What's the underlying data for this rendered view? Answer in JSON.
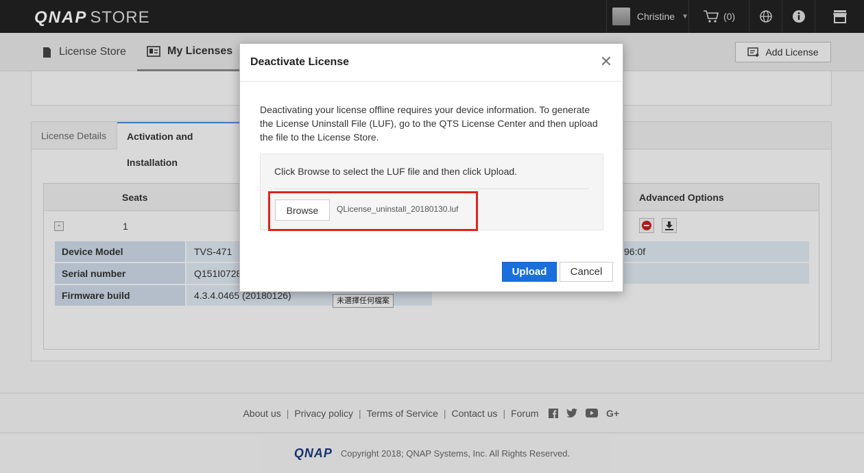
{
  "topbar": {
    "brand": "QNAP",
    "store": "STORE",
    "user_name": "Christine",
    "cart_count": "(0)"
  },
  "nav": {
    "license_store": "License Store",
    "my_licenses": "My Licenses",
    "add_license": "Add License"
  },
  "tabs": {
    "license_details": "License Details",
    "activation": "Activation and Installation"
  },
  "table": {
    "seats_header": "Seats",
    "advanced_header": "Advanced Options",
    "toggle": "-",
    "seat_value": "1",
    "rows": [
      {
        "label": "Device Model",
        "value": "TVS-471",
        "extra": "96:0f"
      },
      {
        "label": "Serial number",
        "value": "Q151I0728",
        "extra": ""
      },
      {
        "label": "Firmware build",
        "value": "4.3.4.0465 (20180126)",
        "extra": ""
      }
    ]
  },
  "tooltip": "未選擇任何檔案",
  "modal": {
    "title": "Deactivate License",
    "description": "Deactivating your license offline requires your device information. To generate the License Uninstall File (LUF), go to the QTS License Center and then upload the file to the License Store.",
    "instruction": "Click Browse to select the LUF file and then click Upload.",
    "browse": "Browse",
    "file_name": "QLicense_uninstall_20180130.luf",
    "upload": "Upload",
    "cancel": "Cancel"
  },
  "footer": {
    "links": [
      "About us",
      "Privacy policy",
      "Terms of Service",
      "Contact us",
      "Forum"
    ],
    "social_icons": [
      "facebook-icon",
      "twitter-icon",
      "youtube-icon",
      "google-plus-icon"
    ],
    "logo": "QNAP",
    "copyright": "Copyright 2018; QNAP Systems, Inc. All Rights Reserved."
  },
  "colors": {
    "accent": "#1a6fdc",
    "highlight_frame": "#d9251d",
    "topbar": "#222222",
    "row_label_bg": "#ccd9e6"
  }
}
